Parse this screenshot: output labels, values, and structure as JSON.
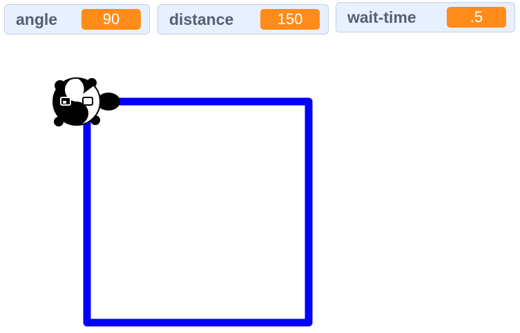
{
  "monitors": [
    {
      "label": "angle",
      "value": "90"
    },
    {
      "label": "distance",
      "value": "150"
    },
    {
      "label": "wait-time",
      "value": ".5"
    }
  ],
  "colors": {
    "pen": "#0000ff",
    "monitor_bg": "#e6f0ff",
    "monitor_value_bg": "#ff8c1a",
    "monitor_label": "#575e75"
  },
  "sprite": {
    "icon": "panda-sprite-icon"
  }
}
